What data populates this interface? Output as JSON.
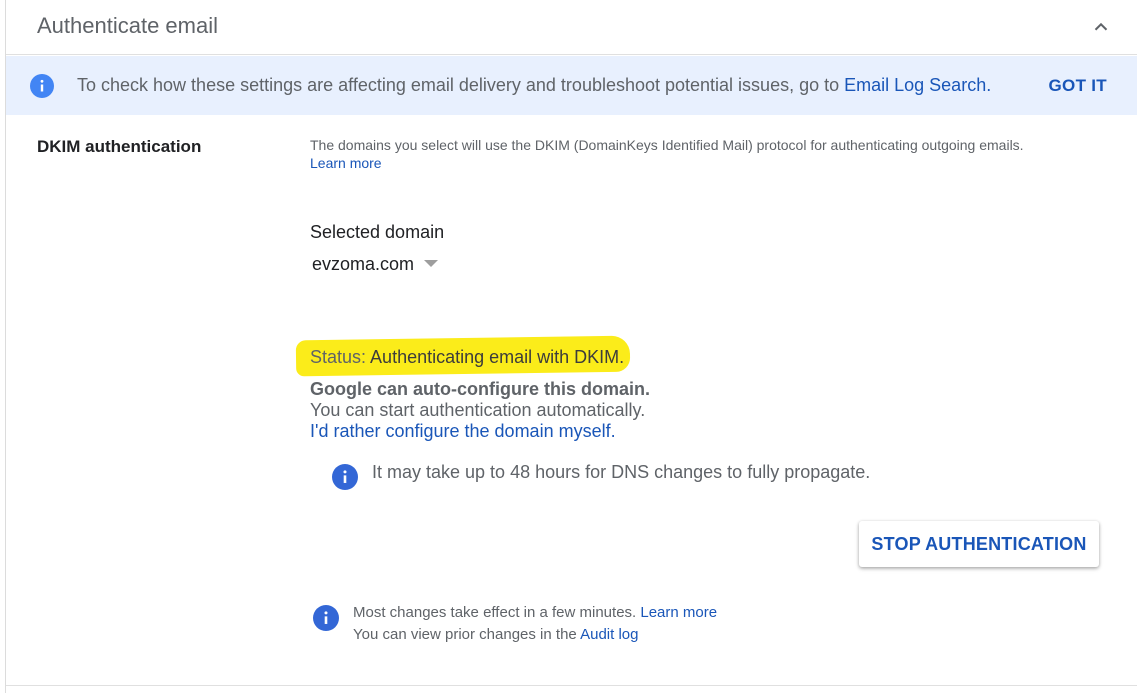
{
  "header": {
    "title": "Authenticate email"
  },
  "banner": {
    "text": "To check how these settings are affecting email delivery and troubleshoot potential issues, go to ",
    "link": "Email Log Search",
    "trailing": ".",
    "dismiss_label": "GOT IT"
  },
  "section": {
    "label": "DKIM authentication",
    "description": "The domains you select will use the DKIM (DomainKeys Identified Mail) protocol for authenticating outgoing emails.",
    "learn_more": "Learn more",
    "selected_domain_label": "Selected domain",
    "selected_domain_value": "evzoma.com",
    "status_prefix": "Status: ",
    "status_value": "Authenticating email with DKIM.",
    "auto_title": "Google can auto-configure this domain.",
    "auto_subtitle": "You can start authentication automatically.",
    "manual_link": "I'd rather configure the domain myself.",
    "dns_note": "It may take up to 48 hours for DNS changes to fully propagate.",
    "stop_button": "STOP AUTHENTICATION"
  },
  "footer_note": {
    "line1_text": "Most changes take effect in a few minutes. ",
    "line1_link": "Learn more",
    "line2_text": "You can view prior changes in the ",
    "line2_link": "Audit log"
  },
  "colors": {
    "accent": "#1a56b8",
    "banner_bg": "#e8f0fe",
    "info_icon": "#3367d6",
    "highlight": "#fbec1a"
  },
  "icons": {
    "collapse": "chevron-up-icon",
    "info": "info-icon"
  }
}
